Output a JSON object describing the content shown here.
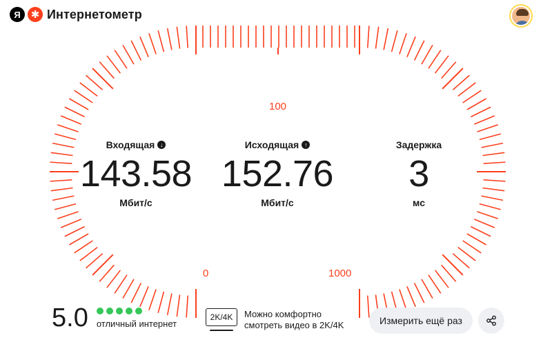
{
  "header": {
    "ya_letter": "Я",
    "service_name": "Интернетометр",
    "icons": [
      "yandex-logo-icon",
      "internetometer-logo-icon",
      "user-avatar"
    ]
  },
  "gauge": {
    "scale_labels": {
      "top": "100",
      "bottom_left": "0",
      "bottom_right": "1000"
    },
    "accent_color": "#fc3f1d"
  },
  "metrics": {
    "download": {
      "title": "Входящая",
      "value": "143.58",
      "unit": "Мбит/с",
      "icon": "arrow-down-icon"
    },
    "upload": {
      "title": "Исходящая",
      "value": "152.76",
      "unit": "Мбит/с",
      "icon": "arrow-up-icon"
    },
    "latency": {
      "title": "Задержка",
      "value": "3",
      "unit": "мс"
    }
  },
  "rating": {
    "score": "5.0",
    "label": "отличный интернет",
    "dots_filled": 5,
    "dots_total": 5,
    "dot_color": "#35c759"
  },
  "video": {
    "badge": "2K/4K",
    "text_line1": "Можно комфортно",
    "text_line2": "смотреть видео в 2K/4K"
  },
  "actions": {
    "measure_again": "Измерить ещё раз",
    "share_icon": "share-icon"
  }
}
